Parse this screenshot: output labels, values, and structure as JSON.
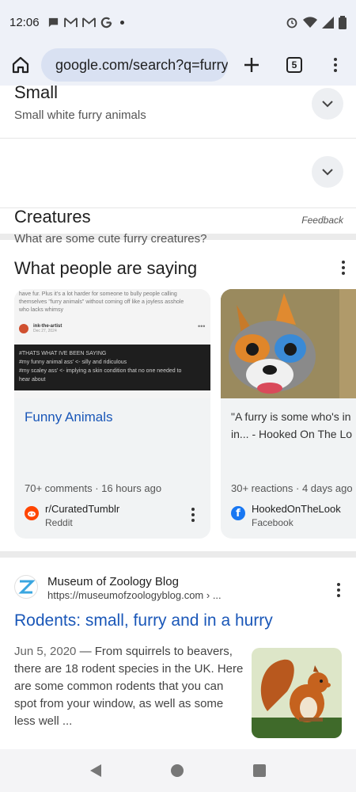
{
  "status_bar": {
    "time": "12:06",
    "left_icons": [
      "chat-bubble-icon",
      "gmail-icon",
      "gmail-icon",
      "google-icon",
      "notification-dot-icon"
    ],
    "right_icons": [
      "alarm-icon",
      "wifi-icon",
      "signal-icon",
      "battery-icon"
    ]
  },
  "browser": {
    "url": "google.com/search?q=furry",
    "tab_count": "5"
  },
  "related": [
    {
      "title": "Small",
      "subtitle": "Small white furry animals"
    },
    {
      "title": "Creatures",
      "subtitle": "What are some cute furry creatures?"
    }
  ],
  "feedback_label": "Feedback",
  "people_saying": {
    "title": "What people are saying",
    "cards": [
      {
        "title": "Funny Animals",
        "meta": "70+ comments · 16 hours ago",
        "source_name": "r/CuratedTumblr",
        "source_site": "Reddit",
        "source_color": "#ff4500",
        "thumb": {
          "top_text_1": "have fur. Plus it's a lot harder for someone to bully people calling",
          "top_text_2": "themselves \"furry animals\" without coming off like a joyless asshole",
          "top_text_3": "who lacks whimsy",
          "user": "ink-the-artist",
          "date": "Dec 27, 2024",
          "dark_line_1": "#THATS WHAT IVE BEEN SAYING",
          "dark_line_2": "#my funny animal ass' <- silly and ridiculous",
          "dark_line_3": "#my scaley ass' <- implying a skin condition that no one needed to",
          "dark_line_4": "hear about"
        }
      },
      {
        "quote_line_1": "\"A furry is some who's in",
        "quote_line_2": "in... - Hooked On The Lo",
        "meta": "30+ reactions · 4 days ago",
        "source_name": "HookedOnTheLook",
        "source_site": "Facebook",
        "source_color": "#1877f2"
      }
    ]
  },
  "result": {
    "site_name": "Museum of Zoology Blog",
    "site_url": "https://museumofzoologyblog.com › ...",
    "title": "Rodents: small, furry and in a hurry",
    "date": "Jun 5, 2020",
    "snippet": " — From squirrels to beavers, there are 18 rodent species in the UK. Here are some common rodents that you can spot from your window, as well as some less well ..."
  }
}
